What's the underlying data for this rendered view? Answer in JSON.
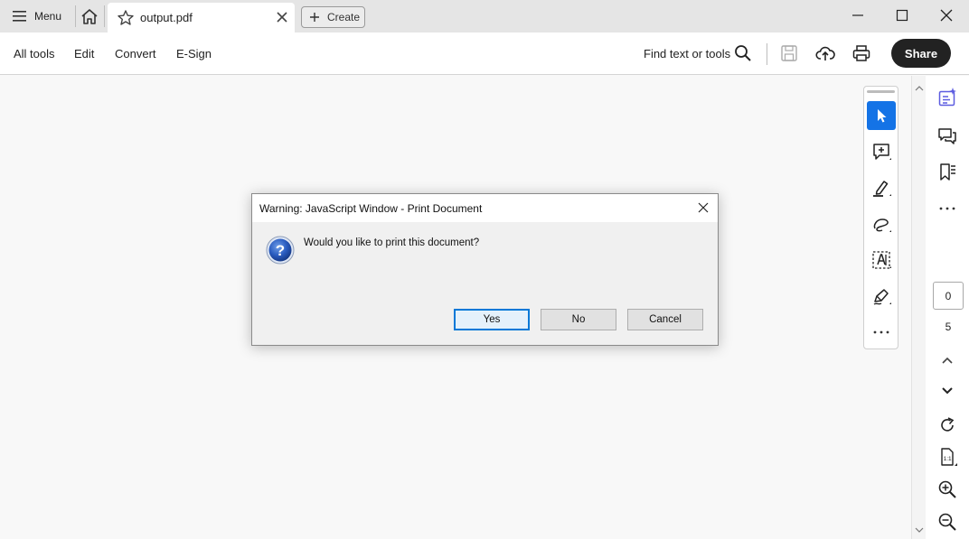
{
  "tabbar": {
    "menu_label": "Menu",
    "tab_title": "output.pdf",
    "create_label": "Create"
  },
  "toolbar": {
    "nav": [
      "All tools",
      "Edit",
      "Convert",
      "E-Sign"
    ],
    "find_label": "Find text or tools",
    "share_label": "Share"
  },
  "quick_tools": [
    "select-cursor-icon",
    "add-comment-icon",
    "highlight-icon",
    "draw-freeform-icon",
    "text-select-icon",
    "sign-icon",
    "more-icon"
  ],
  "rail": {
    "icons": [
      "ai-assistant-icon",
      "comments-icon",
      "bookmarks-icon",
      "more-icon"
    ],
    "current_page": "0",
    "total_pages": "5",
    "bottom_icons": [
      "page-up-icon",
      "page-down-icon",
      "rotate-icon",
      "actual-size-icon",
      "zoom-in-icon",
      "zoom-out-icon"
    ]
  },
  "dialog": {
    "title": "Warning: JavaScript Window - Print Document",
    "message": "Would you like to print this document?",
    "buttons": {
      "yes": "Yes",
      "no": "No",
      "cancel": "Cancel"
    }
  },
  "colors": {
    "accent": "#1473e6",
    "share_bg": "#222222",
    "tabbar_bg": "#e5e5e5",
    "ai_icon": "#5c5ce0"
  }
}
